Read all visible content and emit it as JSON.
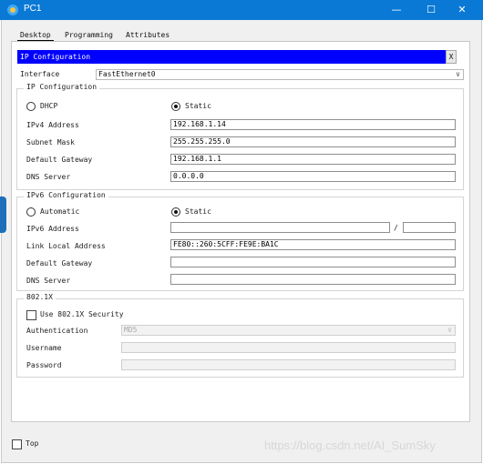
{
  "window": {
    "title": "PC1",
    "minimize": "—",
    "maximize": "☐",
    "close": "✕"
  },
  "tabs": [
    {
      "label": "Desktop"
    },
    {
      "label": "Programming"
    },
    {
      "label": "Attributes"
    }
  ],
  "ip_config_bar": {
    "title": "IP Configuration",
    "close": "X"
  },
  "interface": {
    "label": "Interface",
    "value": "FastEthernet0"
  },
  "ipv4": {
    "group_title": "IP Configuration",
    "dhcp_label": "DHCP",
    "static_label": "Static",
    "mode": "Static",
    "fields": [
      {
        "label": "IPv4 Address",
        "value": "192.168.1.14"
      },
      {
        "label": "Subnet Mask",
        "value": "255.255.255.0"
      },
      {
        "label": "Default Gateway",
        "value": "192.168.1.1"
      },
      {
        "label": "DNS Server",
        "value": "0.0.0.0"
      }
    ]
  },
  "ipv6": {
    "group_title": "IPv6 Configuration",
    "automatic_label": "Automatic",
    "static_label": "Static",
    "mode": "Static",
    "address_label": "IPv6 Address",
    "address_value": "",
    "prefix_sep": "/",
    "prefix_value": "",
    "fields": [
      {
        "label": "Link Local Address",
        "value": "FE80::260:5CFF:FE9E:BA1C"
      },
      {
        "label": "Default Gateway",
        "value": ""
      },
      {
        "label": "DNS Server",
        "value": ""
      }
    ]
  },
  "dot1x": {
    "group_title": "802.1X",
    "use_label": "Use 802.1X Security",
    "use_checked": false,
    "auth_label": "Authentication",
    "auth_value": "MD5",
    "username_label": "Username",
    "username_value": "",
    "password_label": "Password",
    "password_value": ""
  },
  "footer": {
    "top_label": "Top",
    "top_checked": false
  },
  "watermark": "https://blog.csdn.net/AI_SumSky",
  "colors": {
    "titlebar": "#0a79d6",
    "ip_bar": "#0000ff"
  },
  "icons": {
    "app": "packet-tracer-pc-icon"
  }
}
